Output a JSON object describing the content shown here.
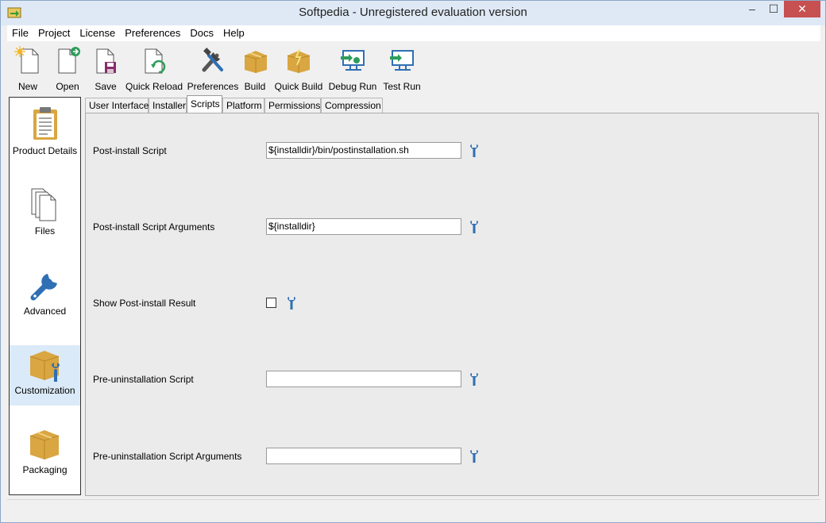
{
  "window": {
    "title": "Softpedia - Unregistered evaluation version",
    "app_icon": "arrow-window-icon",
    "controls": {
      "minimize": "–",
      "maximize": "☐",
      "close": "✕"
    }
  },
  "menubar": {
    "items": [
      {
        "label": "File"
      },
      {
        "label": "Project"
      },
      {
        "label": "License"
      },
      {
        "label": "Preferences"
      },
      {
        "label": "Docs"
      },
      {
        "label": "Help"
      }
    ]
  },
  "toolbar": {
    "items": [
      {
        "label": "New",
        "icon": "new-file-icon"
      },
      {
        "label": "Open",
        "icon": "open-file-icon"
      },
      {
        "label": "Save",
        "icon": "save-icon"
      },
      {
        "label": "Quick Reload",
        "icon": "reload-icon"
      },
      {
        "label": "Preferences",
        "icon": "tools-icon"
      },
      {
        "label": "Build",
        "icon": "build-box-icon"
      },
      {
        "label": "Quick Build",
        "icon": "quick-build-icon"
      },
      {
        "label": "Debug Run",
        "icon": "debug-run-icon"
      },
      {
        "label": "Test Run",
        "icon": "test-run-icon"
      }
    ]
  },
  "sidebar": {
    "items": [
      {
        "label": "Product Details",
        "icon": "clipboard-icon"
      },
      {
        "label": "Files",
        "icon": "files-icon"
      },
      {
        "label": "Advanced",
        "icon": "wrench-icon"
      },
      {
        "label": "Customization",
        "icon": "box-wrench-icon",
        "active": true
      },
      {
        "label": "Packaging",
        "icon": "package-box-icon"
      }
    ]
  },
  "tabs": {
    "items": [
      {
        "label": "User Interface"
      },
      {
        "label": "Installer"
      },
      {
        "label": "Scripts",
        "active": true
      },
      {
        "label": "Platform"
      },
      {
        "label": "Permissions"
      },
      {
        "label": "Compression"
      }
    ]
  },
  "scripts": {
    "post_install_script": {
      "label": "Post-install Script",
      "value": "${installdir}/bin/postinstallation.sh"
    },
    "post_install_args": {
      "label": "Post-install Script Arguments",
      "value": "${installdir}"
    },
    "show_post_install_result": {
      "label": "Show Post-install Result",
      "checked": false
    },
    "pre_uninstall_script": {
      "label": "Pre-uninstallation Script",
      "value": ""
    },
    "pre_uninstall_args": {
      "label": "Pre-uninstallation Script Arguments",
      "value": ""
    }
  },
  "colors": {
    "accent_blue": "#2f6fb3",
    "box_gold": "#d9a641",
    "active_sidebar": "#dbeaf8",
    "close_red": "#c75050"
  }
}
